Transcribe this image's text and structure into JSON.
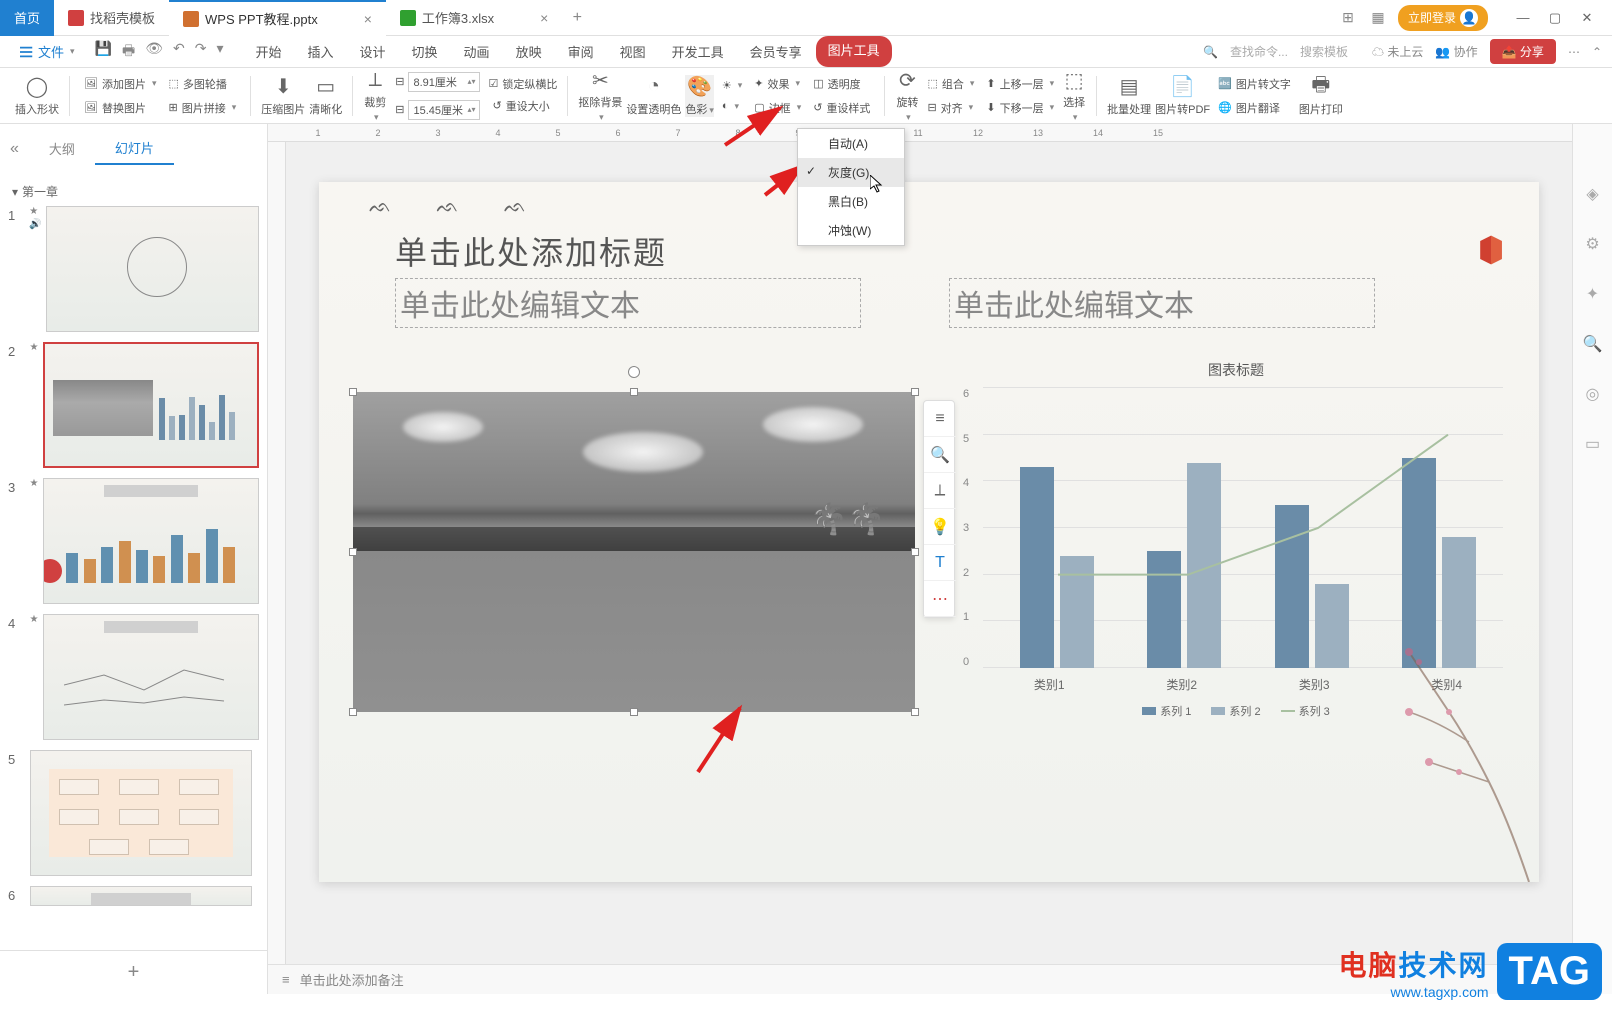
{
  "title_bar": {
    "home_tab": "首页",
    "template_tab": "找稻壳模板",
    "file_tab_1": "WPS PPT教程.pptx",
    "file_tab_2": "工作簿3.xlsx",
    "login_label": "立即登录"
  },
  "menu_bar": {
    "file_btn": "文件",
    "items": [
      "开始",
      "插入",
      "设计",
      "切换",
      "动画",
      "放映",
      "审阅",
      "视图",
      "开发工具",
      "会员专享"
    ],
    "active_item": "图片工具",
    "search_cmd_placeholder": "查找命令...",
    "search_tpl_placeholder": "搜索模板",
    "cloud_label": "未上云",
    "collab_label": "协作",
    "share_label": "分享"
  },
  "ribbon": {
    "insert_shape": "插入形状",
    "add_picture": "添加图片",
    "multi_outline": "多图轮播",
    "replace_pic": "替换图片",
    "pic_stitch": "图片拼接",
    "compress_pic": "压缩图片",
    "clarity": "清晰化",
    "crop": "裁剪",
    "width_value": "8.91厘米",
    "height_value": "15.45厘米",
    "lock_ratio": "锁定纵横比",
    "reset_size": "重设大小",
    "remove_bg": "抠除背景",
    "set_transparent": "设置透明色",
    "color_effect": "色彩",
    "effects": "效果",
    "border": "边框",
    "transparency": "透明度",
    "reset_style": "重设样式",
    "rotate": "旋转",
    "align": "对齐",
    "group": "组合",
    "move_up": "上移一层",
    "move_down": "下移一层",
    "select": "选择",
    "batch": "批量处理",
    "to_pdf": "图片转PDF",
    "to_text": "图片转文字",
    "translate": "图片翻译",
    "print": "图片打印"
  },
  "color_dropdown": {
    "auto": "自动(A)",
    "grayscale": "灰度(G)",
    "bw": "黑白(B)",
    "washout": "冲蚀(W)"
  },
  "slide_nav": {
    "outline_tab": "大纲",
    "slides_tab": "幻灯片",
    "section_1": "第一章"
  },
  "slide_content": {
    "title_placeholder": "单击此处添加标题",
    "text_placeholder_1": "单击此处编辑文本",
    "text_placeholder_2": "单击此处编辑文本"
  },
  "chart_data": {
    "type": "bar",
    "title": "图表标题",
    "categories": [
      "类别1",
      "类别2",
      "类别3",
      "类别4"
    ],
    "series": [
      {
        "name": "系列 1",
        "values": [
          4.3,
          2.5,
          3.5,
          4.5
        ],
        "color": "#6a8ca8"
      },
      {
        "name": "系列 2",
        "values": [
          2.4,
          4.4,
          1.8,
          2.8
        ],
        "color": "#9cb0c0"
      },
      {
        "name": "系列 3",
        "values": [
          2.0,
          2.0,
          3.0,
          5.0
        ],
        "color": "#a8c0a0",
        "chart_type": "line"
      }
    ],
    "ylim": [
      0,
      6
    ],
    "y_ticks": [
      0,
      1,
      2,
      3,
      4,
      5,
      6
    ]
  },
  "notes_bar": {
    "placeholder": "单击此处添加备注"
  },
  "watermark": {
    "line1_a": "电脑",
    "line1_b": "技术网",
    "url": "www.tagxp.com",
    "tag": "TAG"
  }
}
